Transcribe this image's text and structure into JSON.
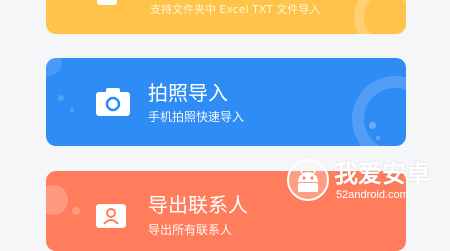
{
  "cards": [
    {
      "subtitle": "支持文件夹中 Excel TXT 文件导入",
      "icon": "import-file-icon",
      "color": "#ffc34a"
    },
    {
      "title": "拍照导入",
      "subtitle": "手机拍照快速导入",
      "icon": "camera-icon",
      "color": "#2f8cf5"
    },
    {
      "title": "导出联系人",
      "subtitle": "导出所有联系人",
      "icon": "contact-export-icon",
      "color": "#ff7d5c"
    }
  ],
  "watermark": {
    "name": "我爱安卓",
    "url": "52android.com",
    "icon": "android-logo-icon"
  }
}
